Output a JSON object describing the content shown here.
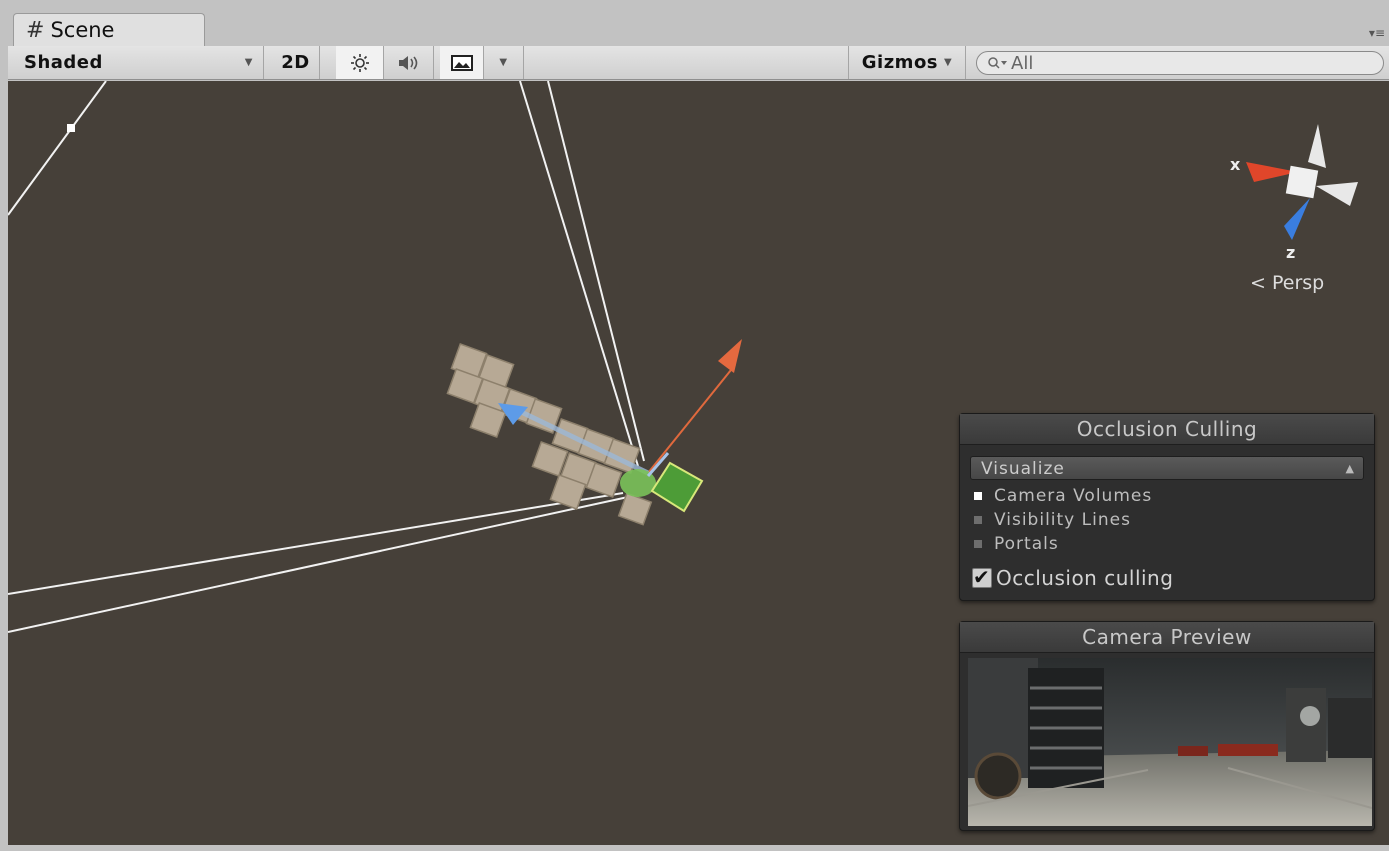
{
  "tab": {
    "icon": "hash-icon",
    "title": "Scene",
    "menu_icon": "▾≡"
  },
  "toolbar": {
    "shading_mode": "Shaded",
    "two_d_label": "2D",
    "lighting_icon": "sun-icon",
    "audio_icon": "speaker-icon",
    "effects_icon": "image-icon",
    "gizmos_label": "Gizmos",
    "search_value": "All",
    "search_icon": "search-icon"
  },
  "scene_gizmo": {
    "x_label": "x",
    "z_label": "z",
    "projection_label": "Persp",
    "colors": {
      "x": "#e0462a",
      "z": "#3a7ee0",
      "neutral": "#e8e8e8"
    }
  },
  "occlusion_panel": {
    "title": "Occlusion Culling",
    "mode": "Visualize",
    "legend": [
      {
        "label": "Camera Volumes",
        "color": "#ffffff"
      },
      {
        "label": "Visibility Lines",
        "color": "#6e6e6e"
      },
      {
        "label": "Portals",
        "color": "#6e6e6e"
      }
    ],
    "checkbox_label": "Occlusion culling",
    "checkbox_checked": true
  },
  "camera_panel": {
    "title": "Camera Preview"
  }
}
